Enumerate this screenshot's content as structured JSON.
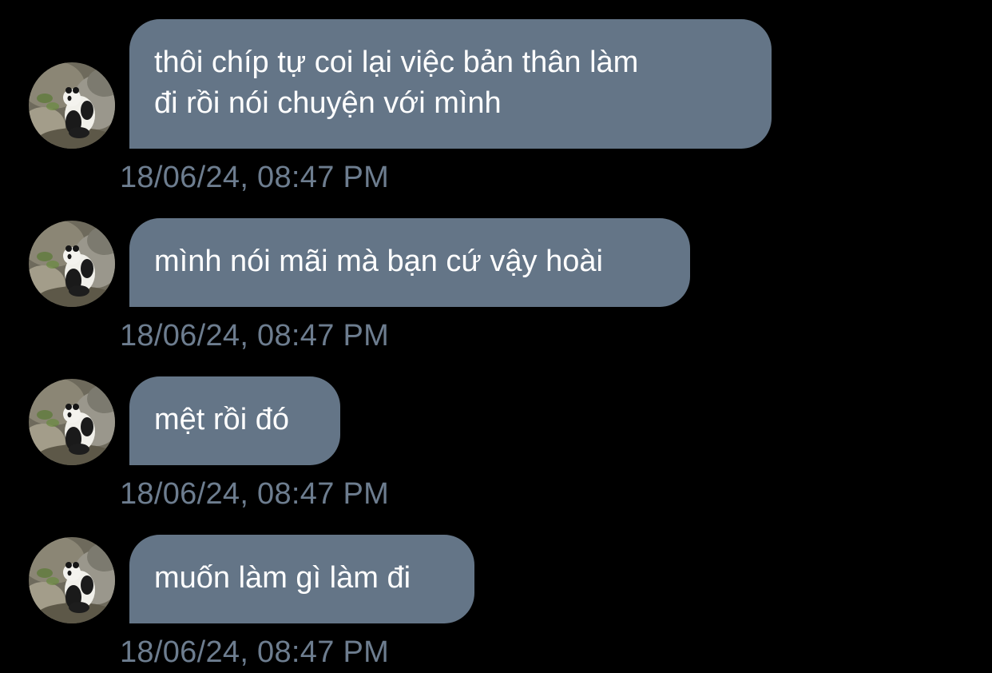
{
  "colors": {
    "background": "#000000",
    "bubble": "#647587",
    "bubble_text": "#ffffff",
    "timestamp": "#6d7d8f"
  },
  "messages": [
    {
      "avatar_icon": "panda-avatar-icon",
      "lines": [
        "thôi chíp tự coi lại việc bản thân làm",
        "đi rồi nói chuyện với mình"
      ],
      "timestamp": "18/06/24, 08:47 PM"
    },
    {
      "avatar_icon": "panda-avatar-icon",
      "lines": [
        "mình nói mãi mà bạn cứ vậy hoài"
      ],
      "timestamp": "18/06/24, 08:47 PM"
    },
    {
      "avatar_icon": "panda-avatar-icon",
      "lines": [
        "mệt rồi đó"
      ],
      "timestamp": "18/06/24, 08:47 PM"
    },
    {
      "avatar_icon": "panda-avatar-icon",
      "lines": [
        "muốn làm gì làm đi"
      ],
      "timestamp": "18/06/24, 08:47 PM"
    }
  ]
}
